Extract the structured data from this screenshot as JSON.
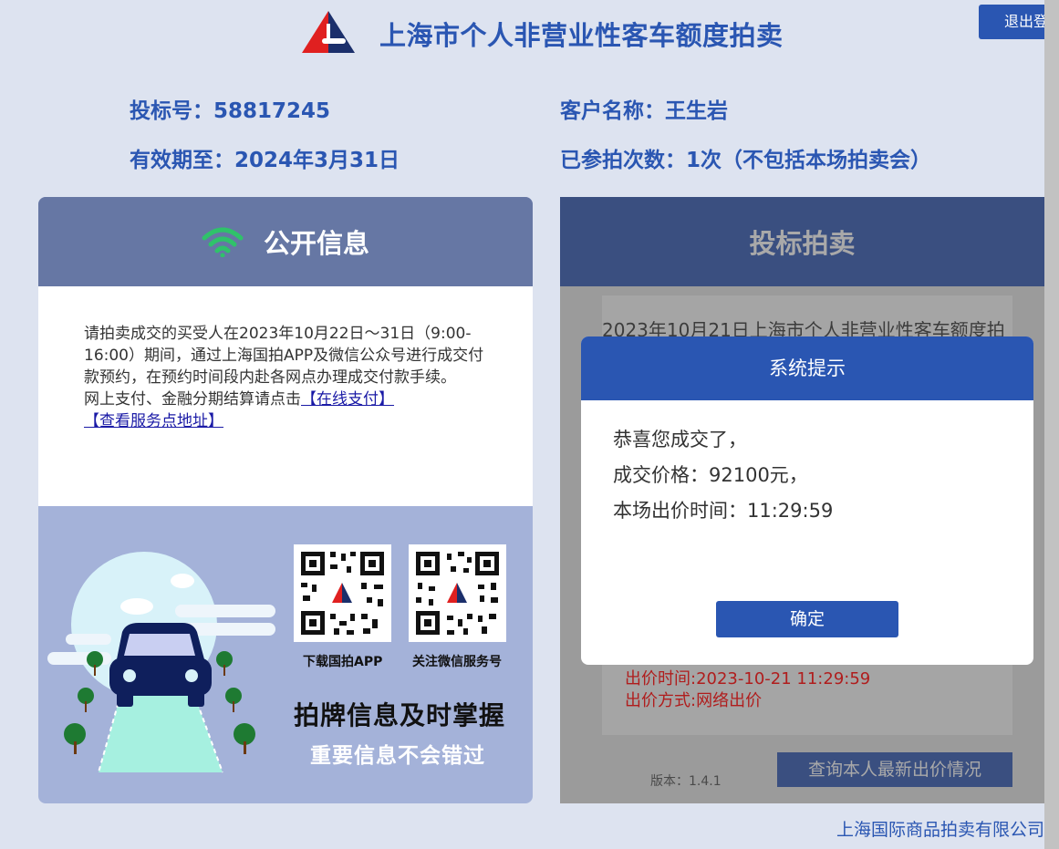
{
  "header": {
    "title": "上海市个人非营业性客车额度拍卖",
    "logout_label": "退出登",
    "logo_icon": "auction-logo-icon"
  },
  "user_info": {
    "bid_number_label": "投标号：58817245",
    "customer_name_label": "客户名称：王生岩",
    "valid_until_label": "有效期至：2024年3月31日",
    "participation_label": "已参拍次数：1次（不包括本场拍卖会）"
  },
  "public_info": {
    "title": "公开信息",
    "icon": "wifi-icon",
    "notice_text": "请拍卖成交的买受人在2023年10月22日～31日（9:00-16:00）期间，通过上海国拍APP及微信公众号进行成交付款预约，在预约时间段内赴各网点办理成交付款手续。",
    "payment_prefix": "网上支付、金融分期结算请点击",
    "online_pay_link": "【在线支付】",
    "service_point_link": "【查看服务点地址】",
    "app_label": "下载国拍APP",
    "wechat_label": "关注微信服务号",
    "slogan_main": "拍牌信息及时掌握",
    "slogan_sub": "重要信息不会错过"
  },
  "bidding": {
    "title": "投标拍卖",
    "auction_title_partial": "2023年10月21日上海市个人非营业性客车额度拍",
    "bid_time": "出价时间:2023-10-21 11:29:59",
    "bid_mode": "出价方式:网络出价",
    "version": "版本：1.4.1",
    "query_button": "查询本人最新出价情况"
  },
  "modal": {
    "title": "系统提示",
    "line1": "恭喜您成交了，",
    "line2": "成交价格：92100元，",
    "line3": "本场出价时间：11:29:59",
    "confirm_label": "确定"
  },
  "footer": {
    "company": "上海国际商品拍卖有限公司"
  },
  "colors": {
    "brand_blue": "#2a56b2",
    "page_bg": "#dde3f0",
    "panel_header": "#6677a4",
    "bid_header": "#3a4f80",
    "alert_red": "#b01d1d"
  }
}
